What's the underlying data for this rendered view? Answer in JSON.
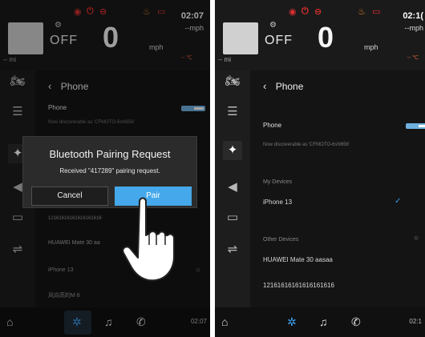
{
  "left_screen": {
    "dashboard": {
      "time": "02:07",
      "mph_readout": "--mph",
      "gear": "OFF",
      "speed": "0",
      "unit": "mph",
      "odometer": "-- mi",
      "temp": "-- ℃"
    },
    "page_title": "Phone",
    "phone_toggle_label": "Phone",
    "discoverable_text": "Now discoverable as 'CFMOTO-6sN656'",
    "device_partial": "12161616161616161616",
    "other_device_partial": "HUAWEI Mate 30 aa",
    "device_iphone": "iPhone 13",
    "device_other": "风向高的M 8",
    "dialog": {
      "title": "Bluetooth Pairing Request",
      "message": "Received \"417289\" pairing request.",
      "cancel_label": "Cancel",
      "pair_label": "Pair"
    },
    "bottom_time": "02:07"
  },
  "right_screen": {
    "dashboard": {
      "time": "02:1(",
      "mph_readout": "--mph",
      "gear": "OFF",
      "speed": "0",
      "unit": "mph",
      "odometer": "-- mi",
      "temp": "-- ℃"
    },
    "page_title": "Phone",
    "phone_toggle_label": "Phone",
    "discoverable_text": "Now discoverable as 'CFMOTO-6sN656'",
    "my_devices_header": "My Devices",
    "my_device": "iPhone 13",
    "other_devices_header": "Other Devices",
    "other_device_1": "HUAWEI Mate 30 aasaa",
    "other_device_2": "12161616161616161616",
    "bottom_time": "02:1"
  },
  "colors": {
    "accent": "#45a8ea",
    "background": "#141414",
    "warning_red": "#e03030",
    "warning_orange": "#e08020"
  }
}
